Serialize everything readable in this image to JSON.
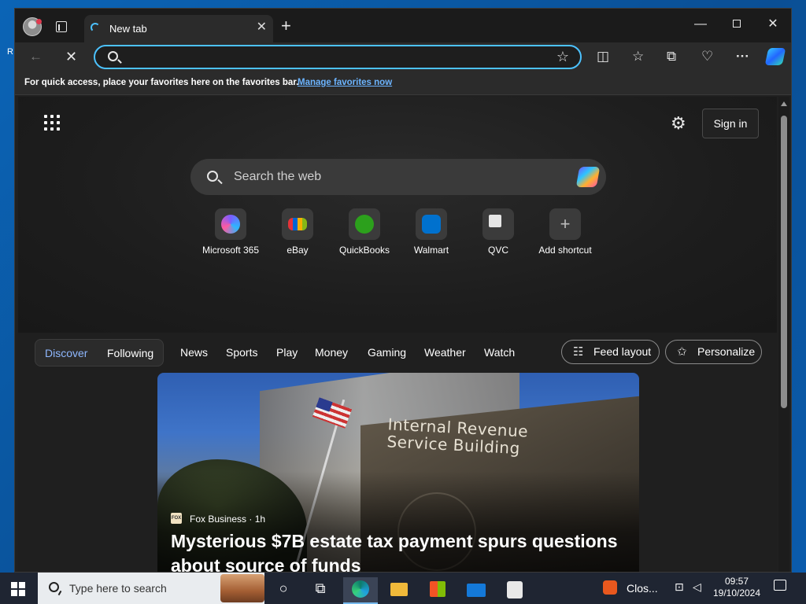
{
  "browser": {
    "tab_title": "New tab",
    "address_value": "",
    "address_placeholder": ""
  },
  "favorites_bar": {
    "message": "For quick access, place your favorites here on the favorites bar.",
    "manage_link": "Manage favorites now"
  },
  "newtab": {
    "signin_label": "Sign in",
    "search_placeholder": "Search the web",
    "shortcuts": [
      {
        "label": "Microsoft 365",
        "icon": "microsoft365-icon"
      },
      {
        "label": "eBay",
        "icon": "ebay-icon"
      },
      {
        "label": "QuickBooks",
        "icon": "quickbooks-icon"
      },
      {
        "label": "Walmart",
        "icon": "walmart-icon"
      },
      {
        "label": "QVC",
        "icon": "qvc-icon"
      },
      {
        "label": "Add shortcut",
        "icon": "plus-icon"
      }
    ]
  },
  "feed": {
    "tabs_primary": [
      "Discover",
      "Following"
    ],
    "tabs": [
      "News",
      "Sports",
      "Play",
      "Money",
      "Gaming",
      "Weather",
      "Watch"
    ],
    "feed_layout_label": "Feed layout",
    "personalize_label": "Personalize",
    "article": {
      "source": "Fox Business",
      "age": "1h",
      "source_line": "Fox Business · 1h",
      "headline": "Mysterious $7B estate tax payment spurs questions about source of funds",
      "image_sign_text": "Internal Revenue Service Building"
    }
  },
  "taskbar": {
    "search_placeholder": "Type here to search",
    "tray_app_label": "Clos...",
    "time": "09:57",
    "date": "19/10/2024"
  },
  "colors": {
    "accent": "#4cc2ff",
    "link": "#6cb4ff",
    "discover_active": "#8fb8ff"
  }
}
